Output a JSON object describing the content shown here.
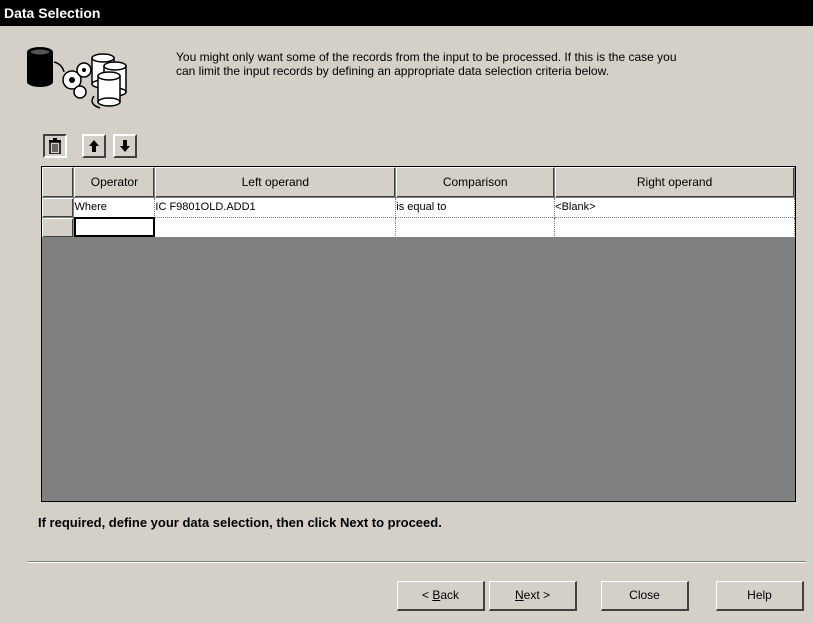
{
  "window": {
    "title": "Data Selection"
  },
  "intro": {
    "line1": "You might only want some of the records from the input to be processed.  If this is the case you",
    "line2": "can limit the input records by defining an appropriate data selection criteria below."
  },
  "toolbar": {
    "delete_icon": "trash-icon",
    "up_icon": "arrow-up-icon",
    "down_icon": "arrow-down-icon"
  },
  "grid": {
    "columns": [
      "Operator",
      "Left operand",
      "Comparison",
      "Right operand"
    ],
    "rows": [
      {
        "operator": "Where",
        "left": "IC F9801OLD.ADD1",
        "comparison": "is equal to",
        "right": "<Blank>"
      },
      {
        "operator": "",
        "left": "",
        "comparison": "",
        "right": ""
      }
    ]
  },
  "hint": "If required, define your data selection, then click Next to proceed.",
  "buttons": {
    "back": {
      "prefix": "< ",
      "mnemonic": "B",
      "rest": "ack"
    },
    "next": {
      "mnemonic": "N",
      "rest": "ext >"
    },
    "close": "Close",
    "help": "Help"
  },
  "colors": {
    "title_bg": "#000000",
    "dialog_bg": "#d4d0c8",
    "grid_bg": "#808080"
  }
}
